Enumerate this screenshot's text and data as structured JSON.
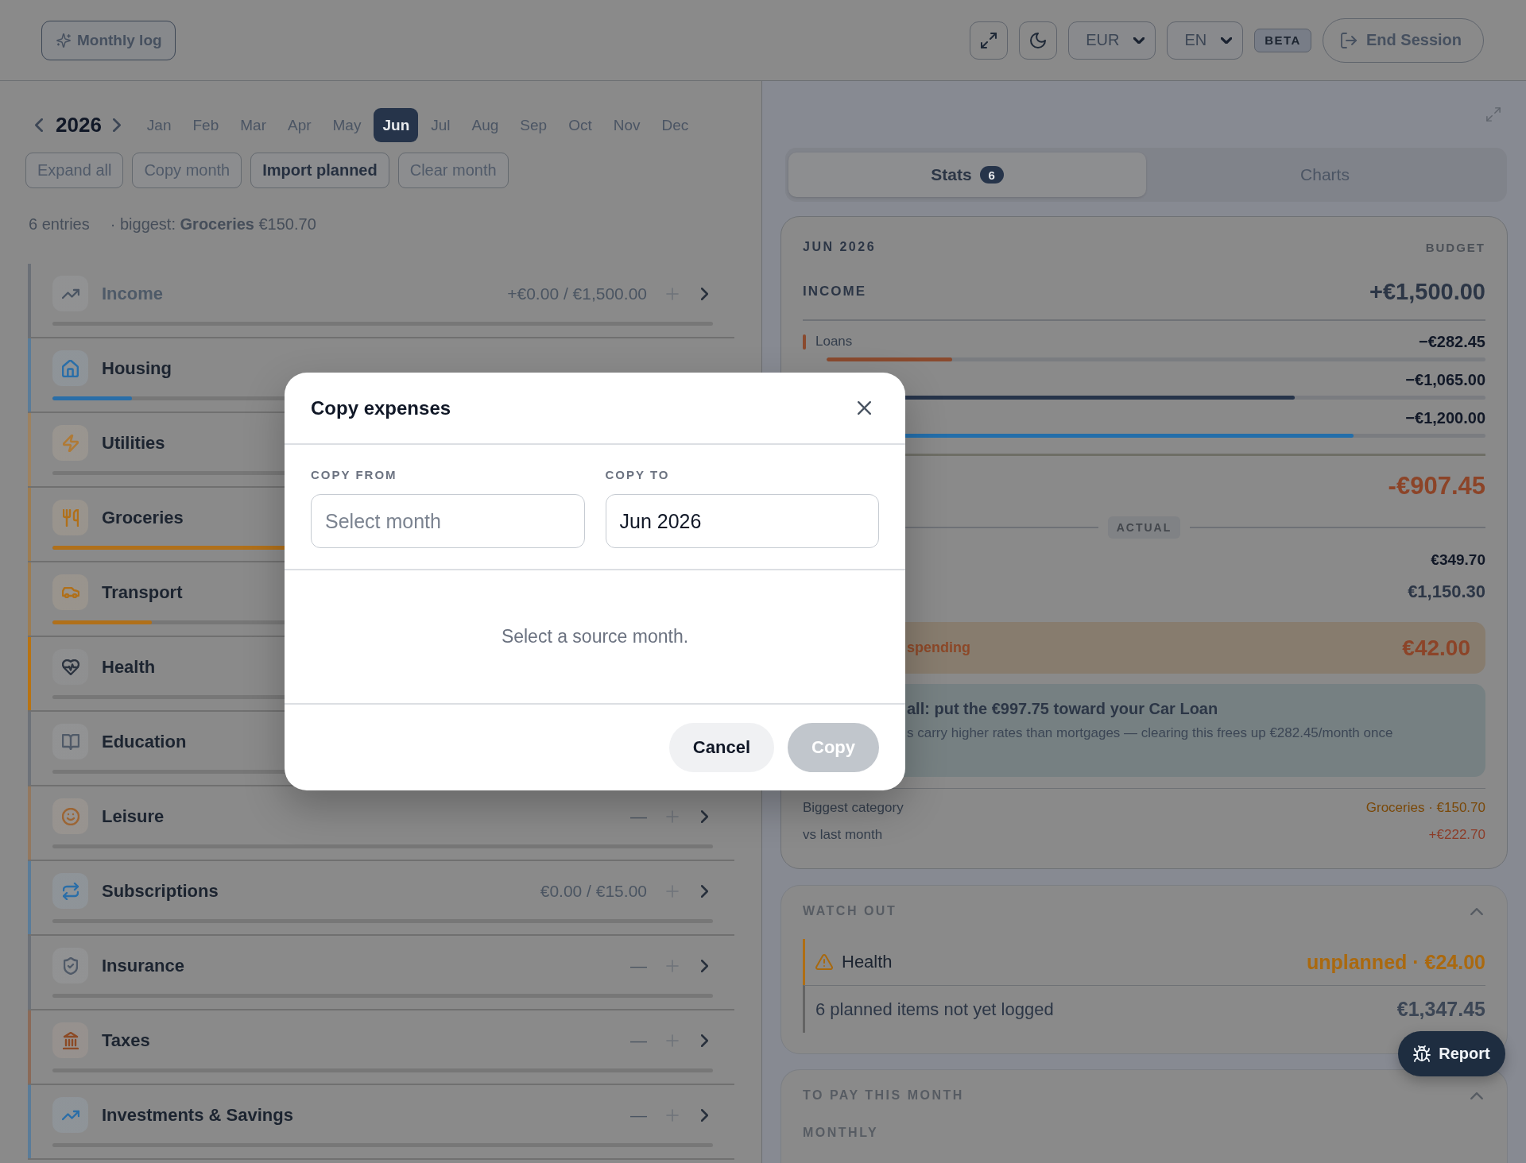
{
  "header": {
    "monthly_log_button": "Monthly log",
    "currency": "EUR",
    "language": "EN",
    "badge": "BETA",
    "end_session_button": "End Session"
  },
  "month_picker": {
    "year": "2026",
    "months": [
      {
        "label": "Jan",
        "selected": false
      },
      {
        "label": "Feb",
        "selected": false
      },
      {
        "label": "Mar",
        "selected": false
      },
      {
        "label": "Apr",
        "selected": false
      },
      {
        "label": "May",
        "selected": false
      },
      {
        "label": "Jun",
        "selected": true
      },
      {
        "label": "Jul",
        "selected": false
      },
      {
        "label": "Aug",
        "selected": false
      },
      {
        "label": "Sep",
        "selected": false
      },
      {
        "label": "Oct",
        "selected": false
      },
      {
        "label": "Nov",
        "selected": false
      },
      {
        "label": "Dec",
        "selected": false
      }
    ]
  },
  "actions": [
    {
      "label": "Expand all",
      "emphasized": false
    },
    {
      "label": "Copy month",
      "emphasized": false
    },
    {
      "label": "Import planned",
      "emphasized": true
    },
    {
      "label": "Clear month",
      "emphasized": false
    }
  ],
  "summary": {
    "count": "6 entries",
    "biggest": "· biggest: **Groceries** €150.70"
  },
  "categories": [
    {
      "name": "Income",
      "kind": "income",
      "color": "#4b5563",
      "flagged": false,
      "amount": "+€0.00 / €1,500.00",
      "level": 0
    },
    {
      "name": "Housing",
      "kind": "expense",
      "color": "#2a6ea8",
      "flagged": false,
      "level": 0.12
    },
    {
      "name": "Utilities",
      "kind": "expense",
      "color": "#b07a35",
      "flagged": false,
      "level": 0
    },
    {
      "name": "Groceries",
      "kind": "expense",
      "color": "#b0701a",
      "flagged": false,
      "level": 0.5
    },
    {
      "name": "Transport",
      "kind": "expense",
      "color": "#b0701a",
      "flagged": false,
      "level": 0.15
    },
    {
      "name": "Health",
      "kind": "expense",
      "color": "#2c3440",
      "flagged": true,
      "level": 0
    },
    {
      "name": "Education",
      "kind": "expense",
      "color": "#505a68",
      "flagged": false,
      "level": 0
    },
    {
      "name": "Leisure",
      "kind": "expense",
      "color": "#9c6534",
      "flagged": false,
      "amount": "—",
      "level": 0
    },
    {
      "name": "Subscriptions",
      "kind": "expense",
      "color": "#2a6ea8",
      "flagged": false,
      "amount": "€0.00 / €15.00",
      "level": 0
    },
    {
      "name": "Insurance",
      "kind": "expense",
      "color": "#505a68",
      "flagged": false,
      "amount": "—",
      "level": 0
    },
    {
      "name": "Taxes",
      "kind": "expense",
      "color": "#8c4a25",
      "flagged": false,
      "amount": "—",
      "level": 0
    },
    {
      "name": "Investments & Savings",
      "kind": "expense",
      "color": "#2a6ea8",
      "flagged": false,
      "amount": "—",
      "level": 0
    }
  ],
  "panel_tabs": [
    {
      "label": "Stats",
      "count": "6",
      "selected": true
    },
    {
      "label": "Charts",
      "selected": false
    }
  ],
  "stats": {
    "period": "JUN 2026",
    "column_label": "BUDGET",
    "income_label": "INCOME",
    "income_total": "+€1,500.00",
    "planned": [
      {
        "label": "Loans",
        "amount": "−€282.45",
        "level": 0.19,
        "color": "#8a4a2e"
      },
      {
        "amount": "−€1,065.00",
        "level": 0.71,
        "color": "#26344a"
      },
      {
        "amount": "−€1,200.00",
        "level": 0.8,
        "color": "#236eaa"
      }
    ],
    "balance": "-€907.45",
    "actual_label": "ACTUAL",
    "actual_values": [
      {
        "value": "€349.70",
        "kind": "minor"
      },
      {
        "value": "€1,150.30",
        "kind": "major"
      }
    ],
    "alert": {
      "text": "spending",
      "amount": "€42.00"
    },
    "tip": {
      "title": "all: put the €997.75 toward your Car Loan",
      "body": "s carry higher rates than mortgages — clearing this frees up €282.45/month once"
    },
    "facts": [
      {
        "label": "Biggest category",
        "value": "Groceries · €150.70",
        "color": "#7a4808"
      },
      {
        "label": "vs last month",
        "value": "+€222.70",
        "color": "#8c3c28"
      }
    ]
  },
  "watch_out": {
    "title": "WATCH OUT",
    "expanded": true,
    "items": [
      {
        "kind": "warning",
        "label": "Health",
        "value": "unplanned · €24.00"
      },
      {
        "kind": "note",
        "label": "6 planned items not yet logged",
        "value": "€1,347.45"
      }
    ]
  },
  "to_pay": {
    "title": "TO PAY THIS MONTH",
    "expanded": true,
    "group": "MONTHLY"
  },
  "report_button": "Report",
  "modal": {
    "title": "Copy expenses",
    "fields": [
      {
        "label": "COPY FROM",
        "placeholder": "Select month"
      },
      {
        "label": "COPY TO",
        "value": "Jun 2026"
      }
    ],
    "message": "Select a source month.",
    "buttons": [
      {
        "label": "Cancel",
        "kind": "secondary",
        "disabled": false
      },
      {
        "label": "Copy",
        "kind": "primary",
        "disabled": true
      }
    ]
  }
}
